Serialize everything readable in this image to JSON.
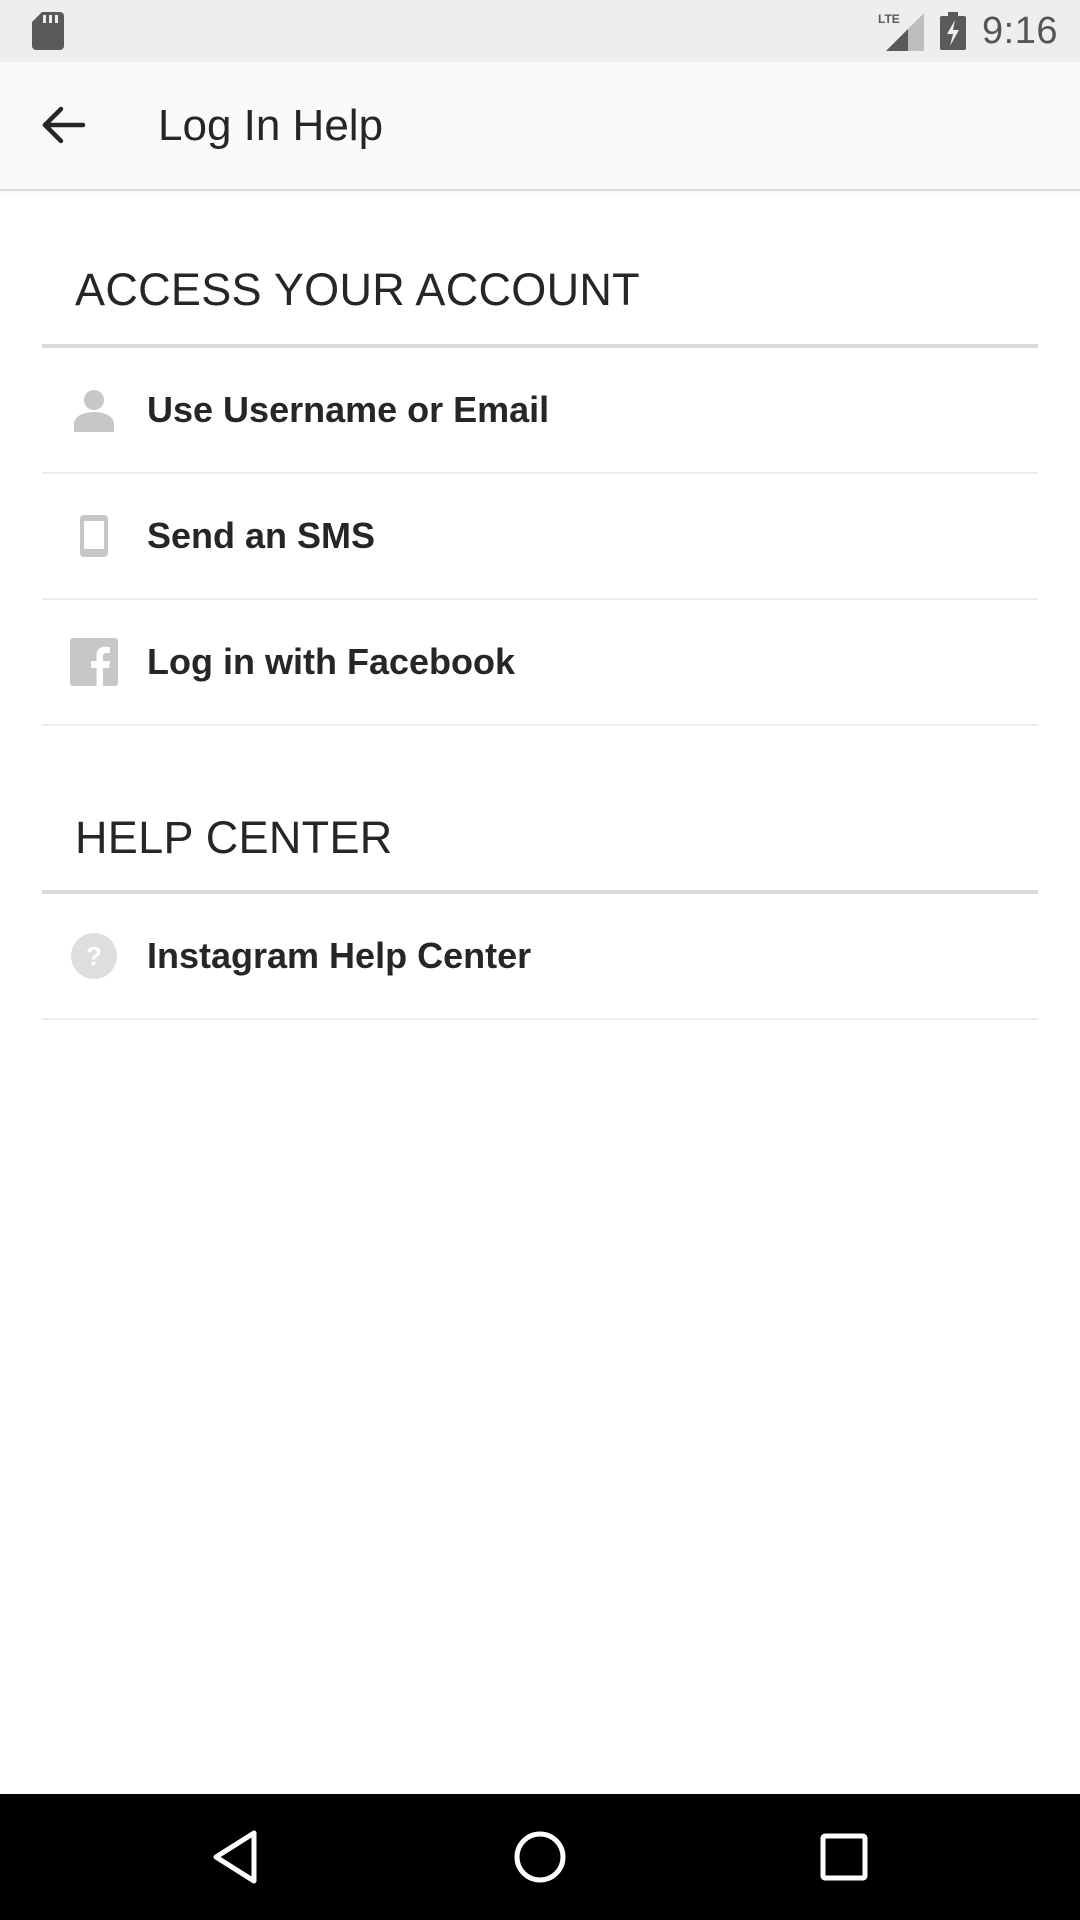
{
  "status_bar": {
    "network": "LTE",
    "clock": "9:16",
    "icons": [
      "sd-card-icon",
      "lte-signal-icon",
      "battery-charging-icon"
    ]
  },
  "toolbar": {
    "title": "Log In Help",
    "back_icon": "arrow-back-icon"
  },
  "sections": {
    "access": {
      "heading": "ACCESS YOUR ACCOUNT",
      "items": [
        {
          "label": "Use Username or Email",
          "icon": "person-icon"
        },
        {
          "label": "Send an SMS",
          "icon": "phone-icon"
        },
        {
          "label": "Log in with Facebook",
          "icon": "facebook-icon"
        }
      ]
    },
    "help": {
      "heading": "HELP CENTER",
      "items": [
        {
          "label": "Instagram Help Center",
          "icon": "help-circle-icon"
        }
      ]
    }
  },
  "nav_bar": {
    "buttons": [
      "back-triangle-icon",
      "home-circle-icon",
      "recents-square-icon"
    ]
  },
  "colors": {
    "text": "#262626",
    "icon_gray": "#c7c7c7",
    "divider": "#dbdbdb",
    "status_bar_bg": "#eeeeee",
    "toolbar_bg": "#fafafa",
    "nav_bar_bg": "#000000"
  }
}
